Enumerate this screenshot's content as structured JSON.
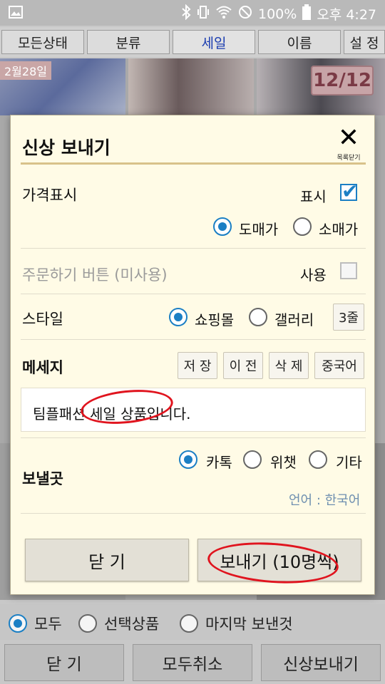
{
  "status_bar": {
    "battery": "100%",
    "time": "오후 4:27",
    "icons": [
      "image-icon",
      "bluetooth-icon",
      "vibrate-icon",
      "wifi-icon",
      "blocked-icon",
      "battery-icon"
    ]
  },
  "tabs": [
    {
      "label": "모든상태"
    },
    {
      "label": "분류"
    },
    {
      "label": "세일",
      "active": true
    },
    {
      "label": "이름"
    },
    {
      "label": "설 정"
    }
  ],
  "gallery": {
    "date_badge": "2월28일",
    "count_badge": "12/12"
  },
  "modal": {
    "title": "신상 보내기",
    "close_caption": "목록닫기",
    "price": {
      "label": "가격표시",
      "show_label": "표시",
      "show_checked": true,
      "options": [
        "도매가",
        "소매가"
      ],
      "selected": "도매가"
    },
    "order_button": {
      "label": "주문하기 버튼 (미사용)",
      "use_label": "사용",
      "use_checked": false
    },
    "style": {
      "label": "스타일",
      "options": [
        "쇼핑몰",
        "갤러리"
      ],
      "selected": "쇼핑몰",
      "rows_button": "3줄"
    },
    "message": {
      "label": "메세지",
      "buttons": [
        "저 장",
        "이 전",
        "삭 제",
        "중국어"
      ],
      "text": "팀플패션 세일 상품입니다."
    },
    "destination": {
      "label": "보낼곳",
      "options": [
        "카톡",
        "위챗",
        "기타"
      ],
      "selected": "카톡",
      "language": "언어 : 한국어"
    },
    "actions": {
      "close": "닫 기",
      "send": "보내기 (10명씩)"
    }
  },
  "bottom": {
    "filters": [
      "모두",
      "선택상품",
      "마지막 보낸것"
    ],
    "selected_filter": "모두",
    "buttons": [
      "닫 기",
      "모두취소",
      "신상보내기"
    ]
  },
  "colors": {
    "accent_blue": "#1b7fc4",
    "annotation_red": "#e0141e",
    "modal_bg": "#fffbe6"
  }
}
